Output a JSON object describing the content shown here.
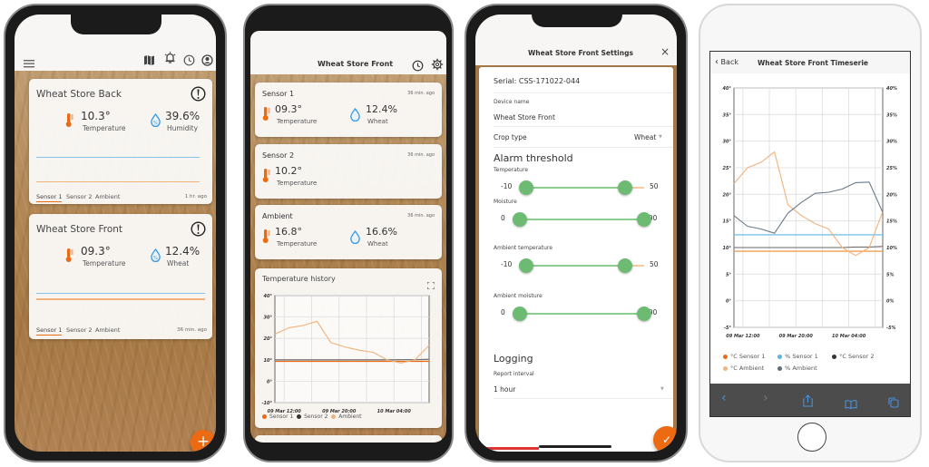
{
  "phone1": {
    "toolbar_icons": [
      "menu-icon",
      "map-icon",
      "alarm-bell-icon",
      "clock-icon",
      "account-icon"
    ],
    "cards": [
      {
        "title": "Wheat Store Back",
        "temperature": "10.3°",
        "temperature_label": "Temperature",
        "moisture": "39.6%",
        "moisture_label": "Humidity",
        "tabs": [
          "Sensor 1",
          "Sensor 2",
          "Ambient"
        ],
        "active_tab": "Sensor 1",
        "updated": "1 hr. ago"
      },
      {
        "title": "Wheat Store Front",
        "temperature": "09.3°",
        "temperature_label": "Temperature",
        "moisture": "12.4%",
        "moisture_label": "Wheat",
        "tabs": [
          "Sensor 1",
          "Sensor 2",
          "Ambient"
        ],
        "active_tab": "Sensor 1",
        "updated": "36 min. ago"
      }
    ],
    "fab_label": "+"
  },
  "phone2": {
    "title": "Wheat Store Front",
    "sensors": [
      {
        "name": "Sensor 1",
        "updated": "36 min. ago",
        "temperature": "09.3°",
        "temperature_label": "Temperature",
        "moisture": "12.4%",
        "moisture_label": "Wheat"
      },
      {
        "name": "Sensor 2",
        "updated": "36 min. ago",
        "temperature": "10.2°",
        "temperature_label": "Temperature"
      },
      {
        "name": "Ambient",
        "updated": "36 min. ago",
        "temperature": "16.8°",
        "temperature_label": "Temperature",
        "moisture": "16.6%",
        "moisture_label": "Wheat"
      }
    ],
    "history_title": "Temperature history",
    "legend": [
      "Sensor 1",
      "Sensor 2",
      "Ambient"
    ]
  },
  "phone3": {
    "title": "Wheat Store Front Settings",
    "close_label": "×",
    "serial": "Serial: CSS-171022-044",
    "device_name_label": "Device name",
    "device_name_value": "Wheat Store Front",
    "crop_type_label": "Crop type",
    "crop_type_value": "Wheat",
    "alarm_heading": "Alarm threshold",
    "sliders": [
      {
        "label": "Temperature",
        "min_label": "-10",
        "max_label": "50",
        "low": 0.05,
        "high": 0.85
      },
      {
        "label": "Moisture",
        "min_label": "0",
        "max_label": "100",
        "low": 0.0,
        "high": 1.0
      },
      {
        "label": "Ambient temperature",
        "min_label": "-10",
        "max_label": "50",
        "low": 0.05,
        "high": 0.85
      },
      {
        "label": "Ambient moisture",
        "min_label": "0",
        "max_label": "100",
        "low": 0.0,
        "high": 1.0
      }
    ],
    "logging_heading": "Logging",
    "report_interval_label": "Report interval",
    "report_interval_value": "1 hour",
    "fab_label": "✓"
  },
  "phone4": {
    "back_label": "Back",
    "title": "Wheat Store Front Timeserie",
    "legend": [
      "°C Sensor 1",
      "% Sensor 1",
      "°C Sensor 2",
      "°C Ambient",
      "% Ambient"
    ]
  },
  "colors": {
    "accent": "#ec6b12",
    "ambient": "#f2b27a",
    "sensor2": "#555555",
    "humidity": "#5ab4e6",
    "slider": "#6dbb72"
  },
  "chart_data": [
    {
      "type": "line",
      "title": "Temperature history",
      "x": [
        "09 Mar 10:00",
        "09 Mar 12:00",
        "09 Mar 14:00",
        "09 Mar 16:00",
        "09 Mar 18:00",
        "09 Mar 20:00",
        "09 Mar 22:00",
        "10 Mar 00:00",
        "10 Mar 02:00",
        "10 Mar 04:00",
        "10 Mar 06:00",
        "10 Mar 08:00"
      ],
      "xticks": [
        "09 Mar 12:00",
        "09 Mar 20:00",
        "10 Mar 04:00"
      ],
      "yticks": [
        "40°",
        "30°",
        "20°",
        "10°",
        "0°",
        "-10°"
      ],
      "ylim": [
        -10,
        40
      ],
      "series": [
        {
          "name": "Sensor 1",
          "values": [
            9.3,
            9.3,
            9.3,
            9.3,
            9.3,
            9.3,
            9.3,
            9.3,
            9.3,
            9.3,
            9.3,
            9.3
          ]
        },
        {
          "name": "Sensor 2",
          "values": [
            10,
            10,
            10,
            10,
            10,
            10,
            10,
            10,
            10,
            10.1,
            10.1,
            10.2
          ]
        },
        {
          "name": "Ambient",
          "values": [
            22,
            25,
            26,
            28,
            18,
            16,
            14.5,
            13.5,
            10,
            8.5,
            10,
            16.8
          ]
        }
      ],
      "grid": true,
      "legend": "bottom"
    },
    {
      "type": "line",
      "title": "Wheat Store Front Timeserie",
      "x": [
        "09 Mar 10:00",
        "09 Mar 12:00",
        "09 Mar 14:00",
        "09 Mar 16:00",
        "09 Mar 18:00",
        "09 Mar 20:00",
        "09 Mar 22:00",
        "10 Mar 00:00",
        "10 Mar 02:00",
        "10 Mar 04:00",
        "10 Mar 06:00",
        "10 Mar 08:00"
      ],
      "xticks": [
        "09 Mar 12:00",
        "09 Mar 20:00",
        "10 Mar 04:00"
      ],
      "yticks_left": [
        "40°",
        "35°",
        "30°",
        "25°",
        "20°",
        "15°",
        "10°",
        "5°",
        "0°",
        "-5°"
      ],
      "yticks_right": [
        "40%",
        "35%",
        "30%",
        "25%",
        "20%",
        "15%",
        "10%",
        "5%",
        "0%",
        "-5%"
      ],
      "ylim": [
        -5,
        40
      ],
      "series": [
        {
          "name": "°C Sensor 1",
          "axis": "left",
          "values": [
            9.3,
            9.3,
            9.3,
            9.3,
            9.3,
            9.3,
            9.3,
            9.3,
            9.3,
            9.3,
            9.3,
            9.3
          ]
        },
        {
          "name": "% Sensor 1",
          "axis": "right",
          "values": [
            12.4,
            12.4,
            12.4,
            12.4,
            12.4,
            12.4,
            12.4,
            12.4,
            12.4,
            12.4,
            12.4,
            12.4
          ]
        },
        {
          "name": "°C Sensor 2",
          "axis": "left",
          "values": [
            10,
            10,
            10,
            10,
            10,
            10,
            10,
            10,
            10,
            10.1,
            10.1,
            10.2
          ]
        },
        {
          "name": "°C Ambient",
          "axis": "left",
          "values": [
            22,
            25,
            26,
            28,
            18,
            16,
            14.5,
            13.5,
            10,
            8.5,
            10,
            16.8
          ]
        },
        {
          "name": "% Ambient",
          "axis": "right",
          "values": [
            16,
            14,
            13.5,
            12.7,
            16.5,
            18.5,
            20.2,
            20.4,
            21,
            22.2,
            22.3,
            16.6
          ]
        }
      ],
      "grid": true,
      "legend": "bottom"
    }
  ]
}
